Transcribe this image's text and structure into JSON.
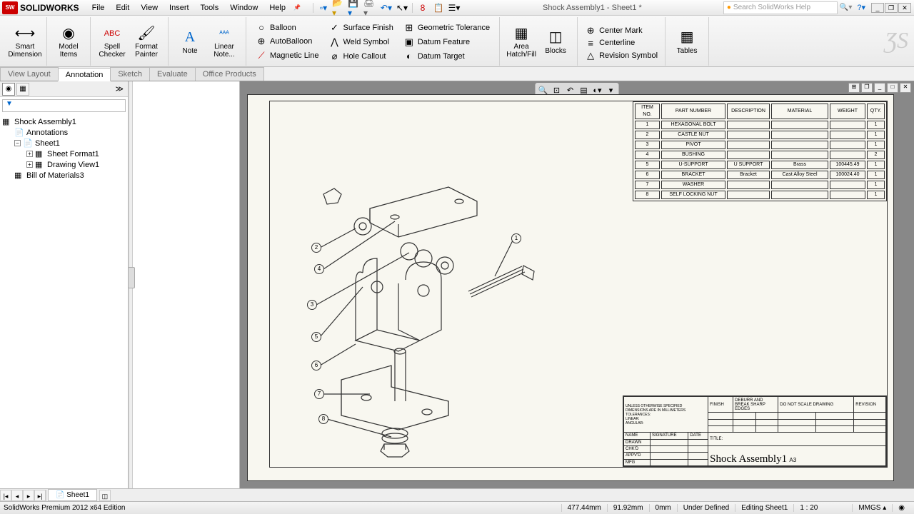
{
  "app": {
    "name": "SOLIDWORKS",
    "logo": "SW"
  },
  "menu": [
    "File",
    "Edit",
    "View",
    "Insert",
    "Tools",
    "Window",
    "Help"
  ],
  "doc_title": "Shock Assembly1 - Sheet1 *",
  "search_placeholder": "Search SolidWorks Help",
  "ribbon": {
    "large": [
      {
        "label": "Smart\nDimension",
        "ico": "⟷"
      },
      {
        "label": "Model\nItems",
        "ico": "◉"
      },
      {
        "label": "Spell\nChecker",
        "ico": "ABC"
      },
      {
        "label": "Format\nPainter",
        "ico": "🖌"
      },
      {
        "label": "Note",
        "ico": "A"
      },
      {
        "label": "Linear\nNote...",
        "ico": "ᴬᴬᴬ"
      }
    ],
    "cols": [
      [
        {
          "l": "Balloon",
          "i": "○"
        },
        {
          "l": "AutoBalloon",
          "i": "⊕"
        },
        {
          "l": "Magnetic Line",
          "i": "⟋"
        }
      ],
      [
        {
          "l": "Surface Finish",
          "i": "✓"
        },
        {
          "l": "Weld Symbol",
          "i": "⋀"
        },
        {
          "l": "Hole Callout",
          "i": "⌀"
        }
      ],
      [
        {
          "l": "Geometric Tolerance",
          "i": "⊞"
        },
        {
          "l": "Datum Feature",
          "i": "▣"
        },
        {
          "l": "Datum Target",
          "i": "◐"
        }
      ]
    ],
    "large2": [
      {
        "label": "Area\nHatch/Fill",
        "ico": "▦"
      },
      {
        "label": "Blocks",
        "ico": "◫"
      }
    ],
    "col2": [
      {
        "l": "Center Mark",
        "i": "⊕"
      },
      {
        "l": "Centerline",
        "i": "≡"
      },
      {
        "l": "Revision Symbol",
        "i": "△"
      }
    ],
    "large3": [
      {
        "label": "Tables",
        "ico": "▦"
      }
    ]
  },
  "ribbon_tabs": [
    "View Layout",
    "Annotation",
    "Sketch",
    "Evaluate",
    "Office Products"
  ],
  "active_ribbon_tab": "Annotation",
  "tree": {
    "filter": "▼",
    "root": "Shock Assembly1",
    "items": [
      {
        "indent": 1,
        "exp": "",
        "ico": "📄",
        "label": "Annotations",
        "color": "#c90"
      },
      {
        "indent": 1,
        "exp": "−",
        "ico": "📄",
        "label": "Sheet1"
      },
      {
        "indent": 2,
        "exp": "+",
        "ico": "▦",
        "label": "Sheet Format1"
      },
      {
        "indent": 2,
        "exp": "+",
        "ico": "▦",
        "label": "Drawing View1"
      },
      {
        "indent": 1,
        "exp": "",
        "ico": "▦",
        "label": "Bill of Materials3"
      }
    ]
  },
  "bom": {
    "headers": [
      "ITEM NO.",
      "PART NUMBER",
      "DESCRIPTION",
      "MATERIAL",
      "WEIGHT",
      "QTY."
    ],
    "rows": [
      [
        "1",
        "HEXAGONAL BOLT",
        "",
        "",
        "",
        "1"
      ],
      [
        "2",
        "CASTLE NUT",
        "",
        "",
        "",
        "1"
      ],
      [
        "3",
        "PIVOT",
        "",
        "",
        "",
        "1"
      ],
      [
        "4",
        "BUSHING",
        "",
        "",
        "",
        "2"
      ],
      [
        "5",
        "U-SUPPORT",
        "U SUPPORT",
        "Brass",
        "100445.49",
        "1"
      ],
      [
        "6",
        "BRACKET",
        "Bracket",
        "Cast Alloy Steel",
        "100024.40",
        "1"
      ],
      [
        "7",
        "WASHER",
        "",
        "",
        "",
        "1"
      ],
      [
        "8",
        "SELF LOCKING NUT",
        "",
        "",
        "",
        "1"
      ]
    ]
  },
  "balloons": [
    "1",
    "2",
    "3",
    "4",
    "5",
    "6",
    "7",
    "8"
  ],
  "titleblock_name": "Shock Assembly1",
  "titleblock_size": "A3",
  "titleblock_label": "DO NOT SCALE DRAWING",
  "titleblock_rev": "REVISION",
  "sheet_tab": "Sheet1",
  "status": {
    "left": "SolidWorks Premium 2012 x64 Edition",
    "coords": [
      "477.44mm",
      "91.92mm",
      "0mm"
    ],
    "state": "Under Defined",
    "mode": "Editing Sheet1",
    "scale": "1 : 20",
    "units": "MMGS"
  }
}
